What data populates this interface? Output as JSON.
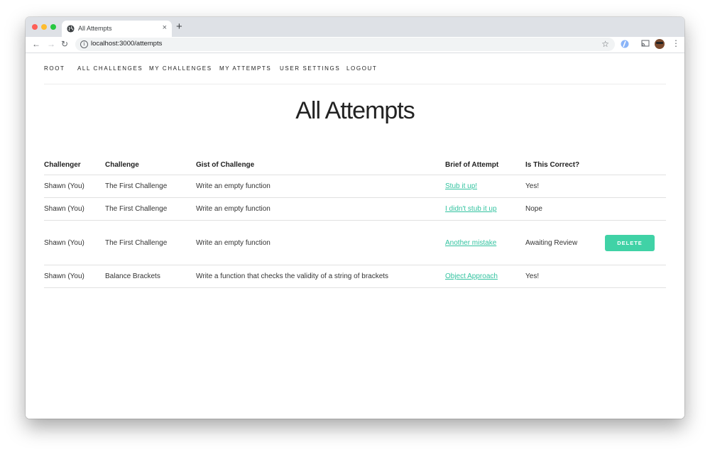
{
  "browser": {
    "tab_title": "All Attempts",
    "tab_close": "×",
    "new_tab": "+",
    "url": "localhost:3000/attempts",
    "info_icon": "i"
  },
  "nav": {
    "items": [
      "ROOT",
      "ALL CHALLENGES",
      "MY CHALLENGES",
      "MY ATTEMPTS",
      "USER SETTINGS",
      "LOGOUT"
    ]
  },
  "page": {
    "title": "All Attempts"
  },
  "table": {
    "headers": [
      "Challenger",
      "Challenge",
      "Gist of Challenge",
      "Brief of Attempt",
      "Is This Correct?"
    ],
    "rows": [
      {
        "challenger": "Shawn (You)",
        "challenge": "The First Challenge",
        "gist": "Write an empty function",
        "brief": "Stub it up!",
        "correct": "Yes!",
        "action": ""
      },
      {
        "challenger": "Shawn (You)",
        "challenge": "The First Challenge",
        "gist": "Write an empty function",
        "brief": "I didn't stub it up",
        "correct": "Nope",
        "action": ""
      },
      {
        "challenger": "Shawn (You)",
        "challenge": "The First Challenge",
        "gist": "Write an empty function",
        "brief": "Another mistake",
        "correct": "Awaiting Review",
        "action": "DELETE"
      },
      {
        "challenger": "Shawn (You)",
        "challenge": "Balance Brackets",
        "gist": "Write a function that checks the validity of a string of brackets",
        "brief": "Object Approach",
        "correct": "Yes!",
        "action": ""
      }
    ]
  },
  "colors": {
    "accent": "#33c3a0",
    "button": "#40d2a6"
  }
}
